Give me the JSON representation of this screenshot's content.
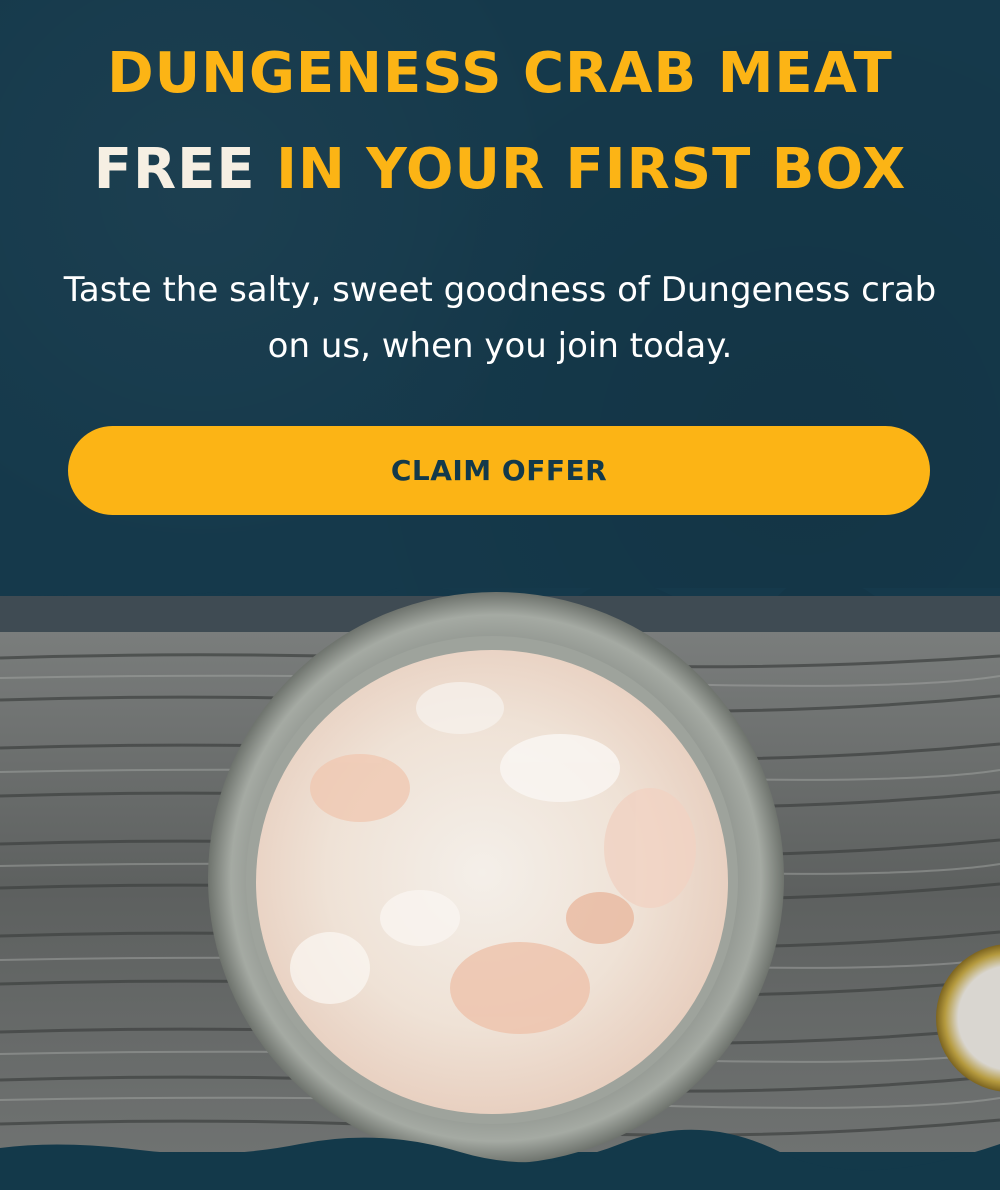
{
  "promo": {
    "headline_line1": "DUNGENESS CRAB MEAT",
    "headline_free": "FREE",
    "headline_rest": " IN YOUR FIRST BOX",
    "subcopy": "Taste the salty, sweet goodness of Dungeness crab on us, when you join today.",
    "cta_label": "CLAIM OFFER"
  },
  "colors": {
    "background": "#15394b",
    "accent": "#fcb415",
    "free_text": "#f6efe3",
    "cta_text": "#13394a"
  },
  "image": {
    "subject": "bowl of dungeness crab meat on weathered wood"
  }
}
